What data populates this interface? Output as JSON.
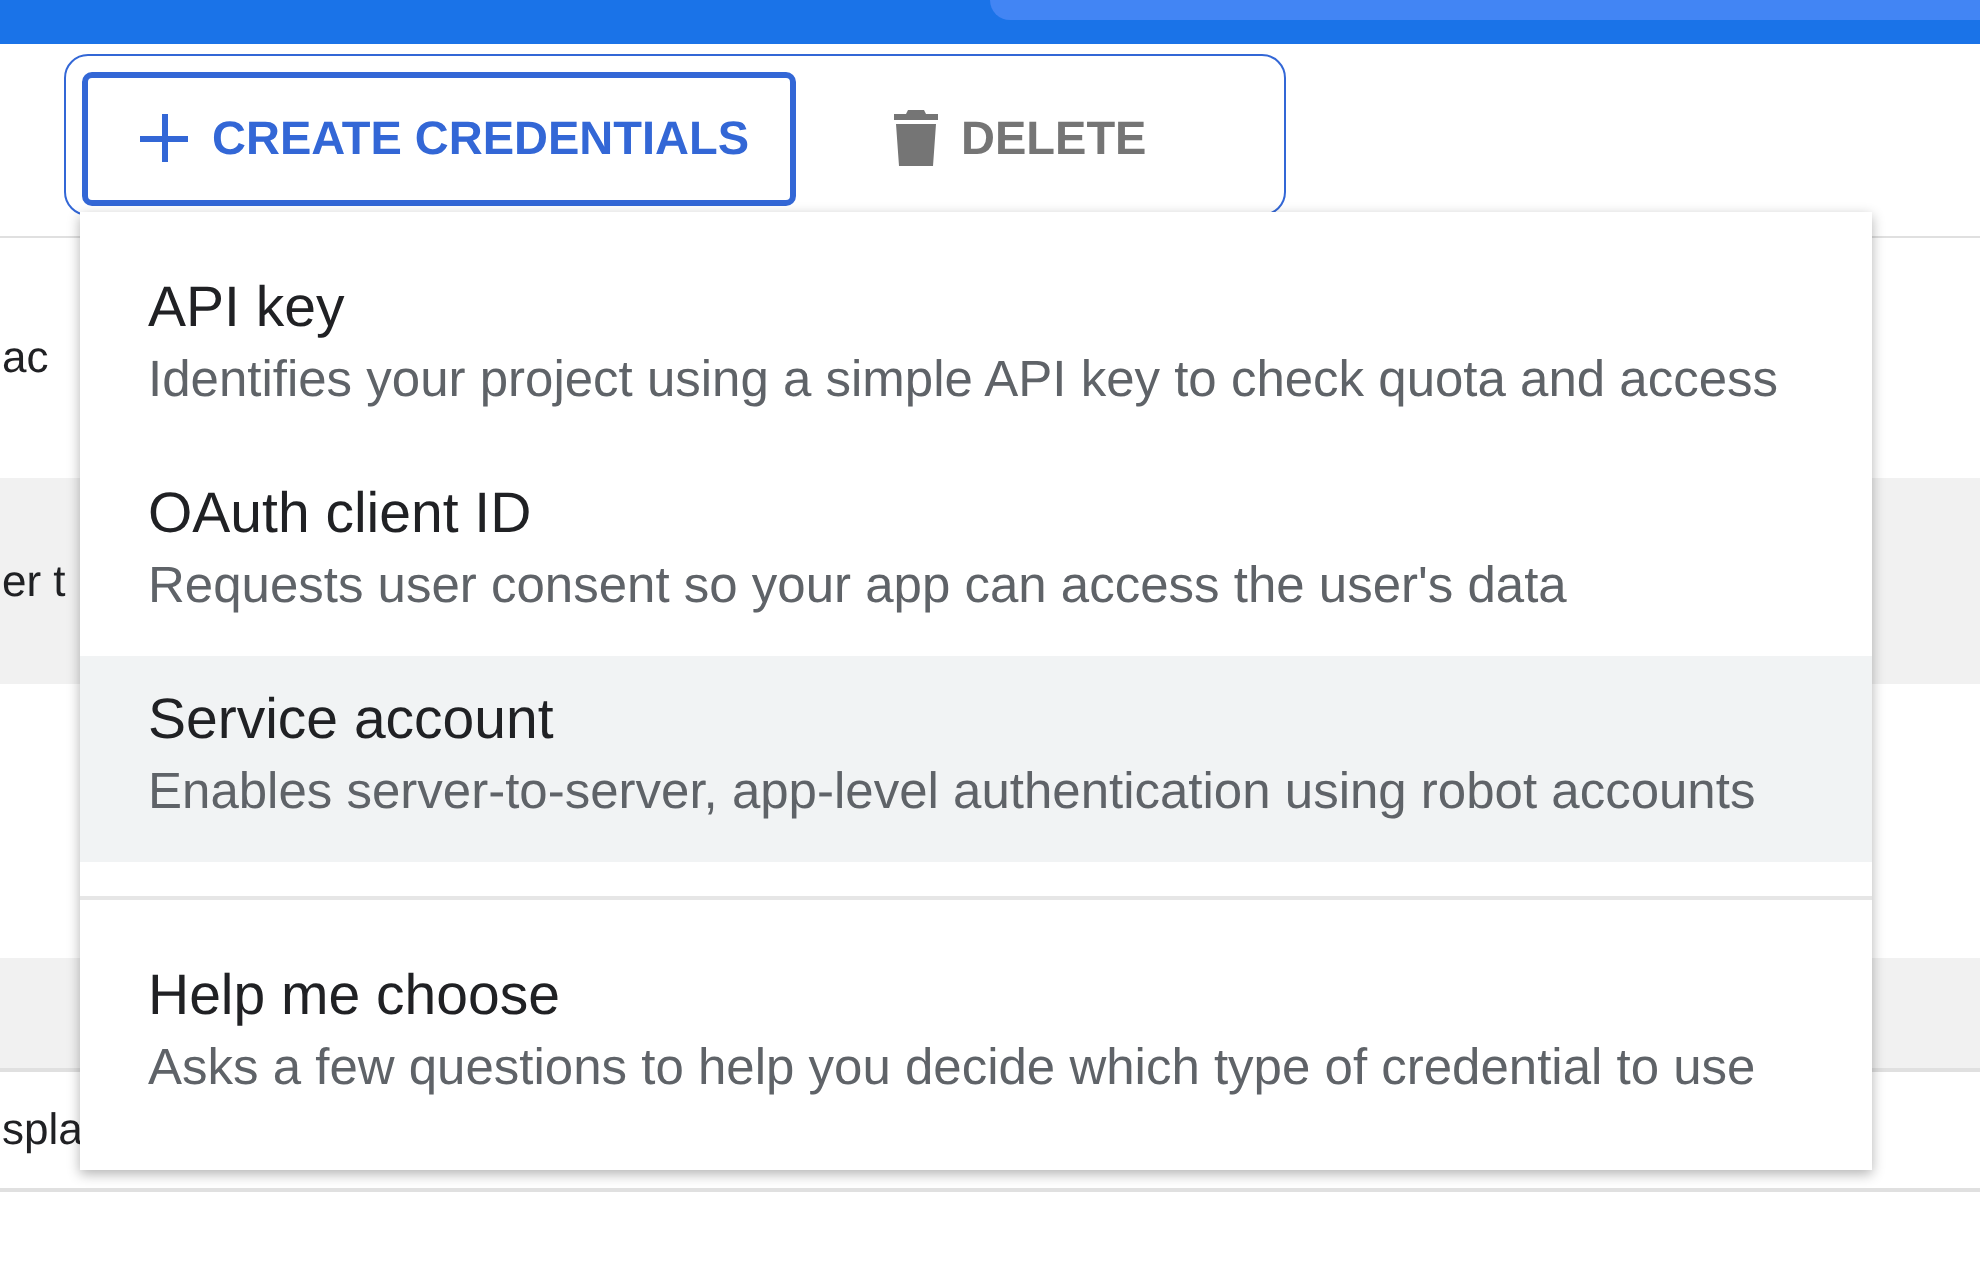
{
  "toolbar": {
    "buttons": [
      {
        "label": "CREATE CREDENTIALS",
        "kind": "create",
        "active": true
      },
      {
        "label": "DELETE",
        "kind": "delete",
        "active": false
      }
    ]
  },
  "background_rows": [
    {
      "text": "ac",
      "shaded": false
    },
    {
      "text": "er t",
      "shaded": true
    },
    {
      "text": "",
      "shaded": false
    },
    {
      "text": "",
      "shaded": true
    },
    {
      "text": "spla",
      "shaded": false
    }
  ],
  "menu": {
    "sections": [
      [
        {
          "title": "API key",
          "description": "Identifies your project using a simple API key to check quota and access",
          "highlighted": false
        },
        {
          "title": "OAuth client ID",
          "description": "Requests user consent so your app can access the user's data",
          "highlighted": false
        },
        {
          "title": "Service account",
          "description": "Enables server-to-server, app-level authentication using robot accounts",
          "highlighted": true
        }
      ],
      [
        {
          "title": "Help me choose",
          "description": "Asks a few questions to help you decide which type of credential to use",
          "highlighted": false
        }
      ]
    ]
  }
}
